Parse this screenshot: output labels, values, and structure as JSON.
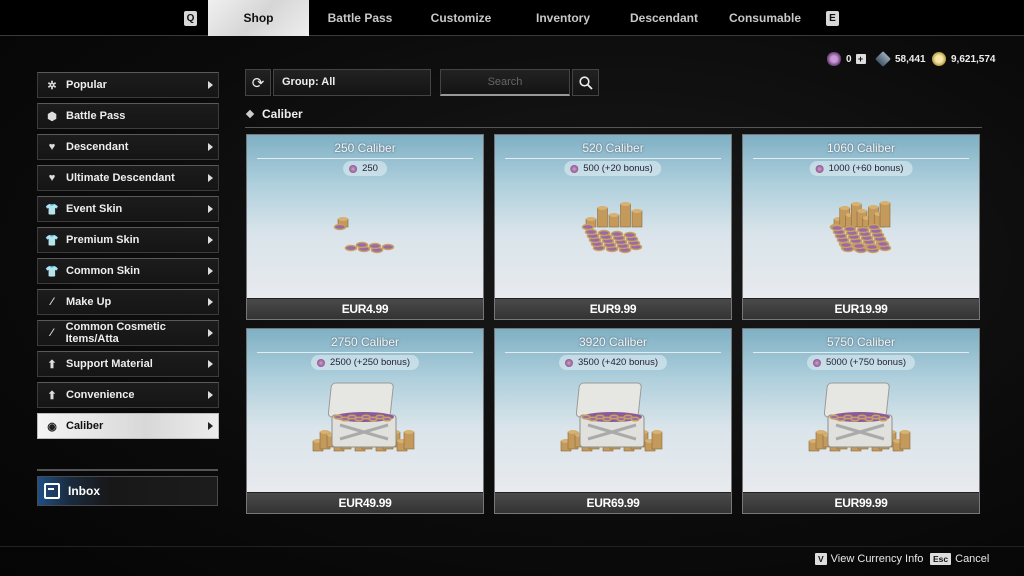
{
  "top_nav": {
    "left_key": "Q",
    "right_key": "E",
    "tabs": [
      {
        "label": "Shop",
        "active": true
      },
      {
        "label": "Battle Pass"
      },
      {
        "label": "Customize"
      },
      {
        "label": "Inventory"
      },
      {
        "label": "Descendant"
      },
      {
        "label": "Consumable"
      }
    ]
  },
  "currencies": [
    {
      "name": "caliber",
      "value": "0",
      "icon": "caliber-icon",
      "has_plus": true
    },
    {
      "name": "crystal",
      "value": "58,441",
      "icon": "crystal-icon"
    },
    {
      "name": "gold",
      "value": "9,621,574",
      "icon": "gold-coin-icon"
    }
  ],
  "sidebar": {
    "items": [
      {
        "label": "Popular",
        "icon": "stars-icon",
        "chevron": true
      },
      {
        "label": "Battle Pass",
        "icon": "battle-pass-icon",
        "chevron": false
      },
      {
        "label": "Descendant",
        "icon": "descendant-icon",
        "chevron": true
      },
      {
        "label": "Ultimate Descendant",
        "icon": "ultimate-descendant-icon",
        "chevron": true
      },
      {
        "label": "Event Skin",
        "icon": "shirt-icon",
        "chevron": true
      },
      {
        "label": "Premium Skin",
        "icon": "shirt-icon",
        "chevron": true
      },
      {
        "label": "Common Skin",
        "icon": "shirt-icon",
        "chevron": true
      },
      {
        "label": "Make Up",
        "icon": "wand-icon",
        "chevron": true
      },
      {
        "label": "Common Cosmetic Items/Atta",
        "icon": "wand-icon",
        "chevron": true
      },
      {
        "label": "Support Material",
        "icon": "support-icon",
        "chevron": true
      },
      {
        "label": "Convenience",
        "icon": "support-icon",
        "chevron": true
      },
      {
        "label": "Caliber",
        "icon": "caliber-icon",
        "chevron": true,
        "active": true
      }
    ],
    "inbox_label": "Inbox"
  },
  "toolbar": {
    "group_label": "Group: All",
    "search_placeholder": "Search"
  },
  "section_title": "Caliber",
  "products": [
    {
      "title": "250 Caliber",
      "amount": "250",
      "price": "EUR4.99",
      "art": "coins-small"
    },
    {
      "title": "520 Caliber",
      "amount": "500 (+20 bonus)",
      "price": "EUR9.99",
      "art": "coins-medium"
    },
    {
      "title": "1060 Caliber",
      "amount": "1000 (+60 bonus)",
      "price": "EUR19.99",
      "art": "coins-large"
    },
    {
      "title": "2750 Caliber",
      "amount": "2500 (+250 bonus)",
      "price": "EUR49.99",
      "art": "chest"
    },
    {
      "title": "3920 Caliber",
      "amount": "3500 (+420 bonus)",
      "price": "EUR69.99",
      "art": "chest"
    },
    {
      "title": "5750 Caliber",
      "amount": "5000 (+750 bonus)",
      "price": "EUR99.99",
      "art": "chest"
    }
  ],
  "footer": {
    "hints": [
      {
        "key": "V",
        "label": "View Currency Info"
      },
      {
        "key": "Esc",
        "label": "Cancel"
      }
    ]
  },
  "colors": {
    "accent_blue": "#1e4f86",
    "card_sky": "#7fb0c4",
    "active_tab": "#e8e8e8"
  }
}
